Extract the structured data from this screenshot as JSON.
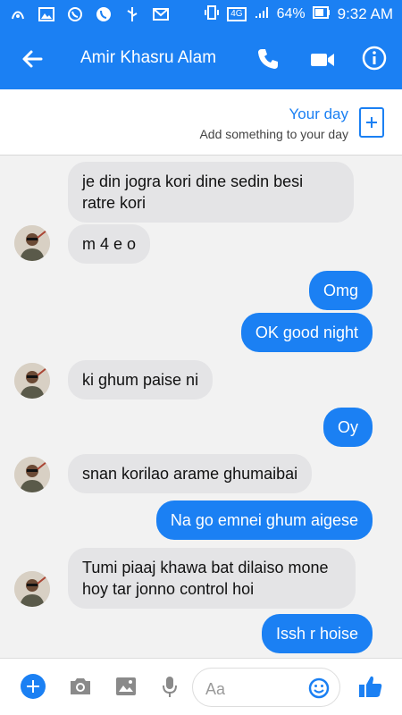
{
  "status": {
    "signal": "4G",
    "battery": "64%",
    "time": "9:32 AM"
  },
  "header": {
    "contact_name": "Amir Khasru Alam"
  },
  "your_day": {
    "title": "Your day",
    "subtitle": "Add something to your day"
  },
  "messages": [
    {
      "from": "them",
      "text": "je din jogra kori dine sedin besi ratre kori"
    },
    {
      "from": "them",
      "text": "m 4 e o"
    },
    {
      "from": "me",
      "text": "Omg"
    },
    {
      "from": "me",
      "text": "OK good night"
    },
    {
      "from": "them",
      "text": "ki ghum paise ni"
    },
    {
      "from": "me",
      "text": "Oy"
    },
    {
      "from": "them",
      "text": "snan korilao arame ghumaibai"
    },
    {
      "from": "me",
      "text": "Na go emnei ghum aigese"
    },
    {
      "from": "them",
      "text": "Tumi piaaj khawa bat dilaiso mone hoy tar jonno control hoi"
    },
    {
      "from": "me",
      "text": "Issh r hoise"
    }
  ],
  "composer": {
    "placeholder": "Aa"
  },
  "colors": {
    "brand": "#1b80f3",
    "incoming_bubble": "#e4e4e6",
    "background": "#f2f2f2"
  },
  "icons": {
    "back": "back-arrow-icon",
    "call": "phone-icon",
    "video": "video-camera-icon",
    "info": "info-icon",
    "camera": "camera-icon",
    "gallery": "image-icon",
    "mic": "microphone-icon",
    "emoji": "emoji-icon",
    "like": "thumbs-up-icon"
  }
}
